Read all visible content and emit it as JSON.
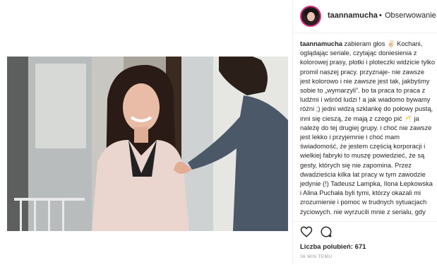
{
  "post": {
    "username": "taannamucha",
    "separator": "•",
    "follow_label": "Obserwowanie",
    "caption_username": "taannamucha",
    "caption_text": "zabieram głos ✌🏻 Kochani, oglądając seriale, czytając doniesienia z kolorowej prasy, plotki i ploteczki widzicie tylko promil naszej pracy. przyznaje- nie zawsze jest kolorowo i nie zawsze jest tak, jakbyśmy sobie to „wymarzyli”. bo ta praca to praca z ludźmi i wśród ludzi ! a jak wiadomo bywamy różni ;) jedni widzą szklankę do połowy pustą, inni się cieszą, że mają z czego pić 🥂 ja należę do tej drugiej grupy. i choć nie zawsze jest lekko i przyjemnie i choć mam świadomość, że jestem częścią korporacji i wielkiej fabryki to muszę powiedzieć, że są gesty, których się nie zapomina. Przez dwadzieścia kilka lat pracy w tym zawodzie jedynie (!) Tadeusz Lampka, Ilona Łepkowska i Alina Puchała byli tymi, którzy okazali mi zrozumienie i pomoc w trudnych sytuacjach życiowych. nie wyrzucili mnie z serialu, gdy",
    "likes_label": "Liczba polubień: 671",
    "time_label": "36 MIN TEMU"
  },
  "icons": {
    "heart": "heart-icon",
    "comment": "comment-icon",
    "avatar": "avatar"
  },
  "colors": {
    "text": "#262626",
    "muted": "#999999",
    "border": "#efefef",
    "avatar_ring": "#d92e7f"
  }
}
